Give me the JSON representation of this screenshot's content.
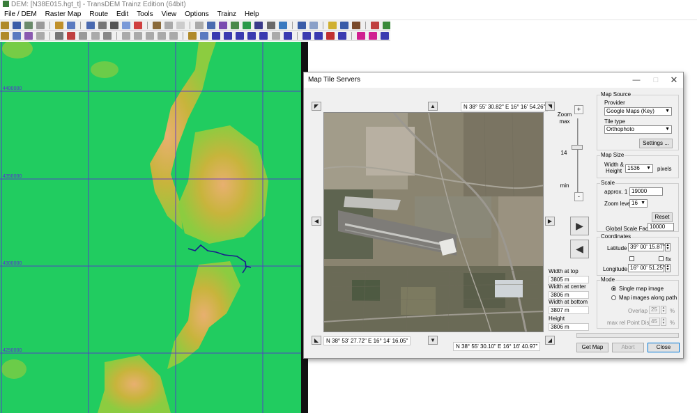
{
  "window": {
    "title": "DEM: [N38E015.hgt_t] - TransDEM Trainz Edition (64bit)"
  },
  "menu": [
    "File / DEM",
    "Raster Map",
    "Route",
    "Edit",
    "Tools",
    "View",
    "Options",
    "Trainz",
    "Help"
  ],
  "map": {
    "northing_labels": [
      "4400000",
      "4350000",
      "4300000",
      "4250000"
    ],
    "colors": {
      "low": "#21cc60",
      "mid": "#c8b43c",
      "high": "#e8a080",
      "grid": "#5a2bd6",
      "path": "#1a1a8c"
    }
  },
  "dialog": {
    "title": "Map Tile Servers",
    "coord_top": "N 38° 55' 30.82\"  E 16° 16' 54.26\"",
    "coord_bottom_left": "N 38° 53' 27.72\"  E 16° 14' 16.05\"",
    "coord_bottom_right": "N 38° 55' 30.10\"  E 16° 16' 40.97\"",
    "zoom": {
      "title": "Zoom",
      "max": "max",
      "min": "min",
      "current": "14",
      "plus": "+",
      "minus": "-"
    },
    "width_top_label": "Width at top",
    "width_top_value": "3805 m",
    "width_center_label": "Width at center",
    "width_center_value": "3806 m",
    "width_bottom_label": "Width at bottom",
    "width_bottom_value": "3807 m",
    "height_label": "Height",
    "height_value": "3806 m",
    "map_source": {
      "title": "Map Source",
      "provider_label": "Provider",
      "provider_value": "Google Maps (Key)",
      "tile_type_label": "Tile type",
      "tile_type_value": "Orthophoto",
      "settings_button": "Settings ..."
    },
    "map_size": {
      "title": "Map Size",
      "label_line1": "Width &",
      "label_line2": "Height",
      "value": "1536",
      "unit": "pixels"
    },
    "scale": {
      "title": "Scale",
      "approx_label": "approx. 1 :",
      "approx_value": "19000",
      "zoom_label": "Zoom level",
      "zoom_value": "16",
      "reset_button": "Reset",
      "global_label": "Global Scale Factor",
      "global_value": "10000"
    },
    "coordinates": {
      "title": "Coordinates",
      "latitude_label": "Latitude",
      "latitude_value": "39° 00' 15.87\"",
      "fix_label": "fix",
      "longitude_label": "Longitude",
      "longitude_value": "16° 00' 51.25\""
    },
    "mode": {
      "title": "Mode",
      "single_label": "Single map image",
      "path_label": "Map images along path",
      "overlap_label": "Overlap",
      "overlap_value": "25",
      "overlap_unit": "%",
      "max_rel_label": "max rel Point Dist",
      "max_rel_value": "45",
      "max_rel_unit": "%"
    },
    "buttons": {
      "get_map": "Get Map",
      "abort": "Abort",
      "close": "Close"
    }
  }
}
